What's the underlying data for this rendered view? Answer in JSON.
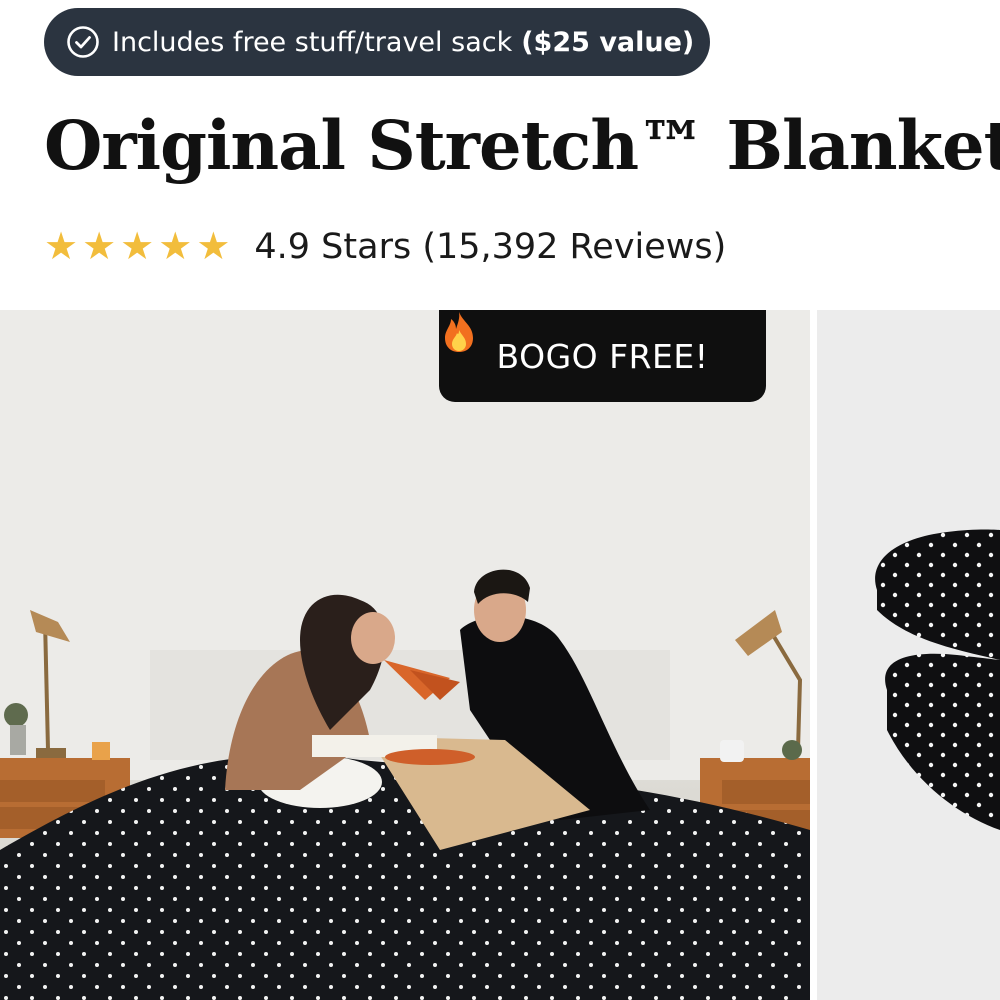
{
  "promo": {
    "text": "Includes free stuff/travel sack",
    "value": "($25 value)",
    "icon": "check-circle-icon"
  },
  "product": {
    "title": "Original Stretch™ Blanket"
  },
  "rating": {
    "stars": 5,
    "stars_max": 5,
    "text": "4.9 Stars (15,392 Reviews)",
    "star_color": "#f2bd3c"
  },
  "gallery": {
    "badge": {
      "icon": "fire-icon",
      "label": "BOGO FREE!"
    }
  },
  "colors": {
    "pill_bg": "#2b3440",
    "badge_bg": "#0f0f0f",
    "star": "#f2bd3c"
  }
}
